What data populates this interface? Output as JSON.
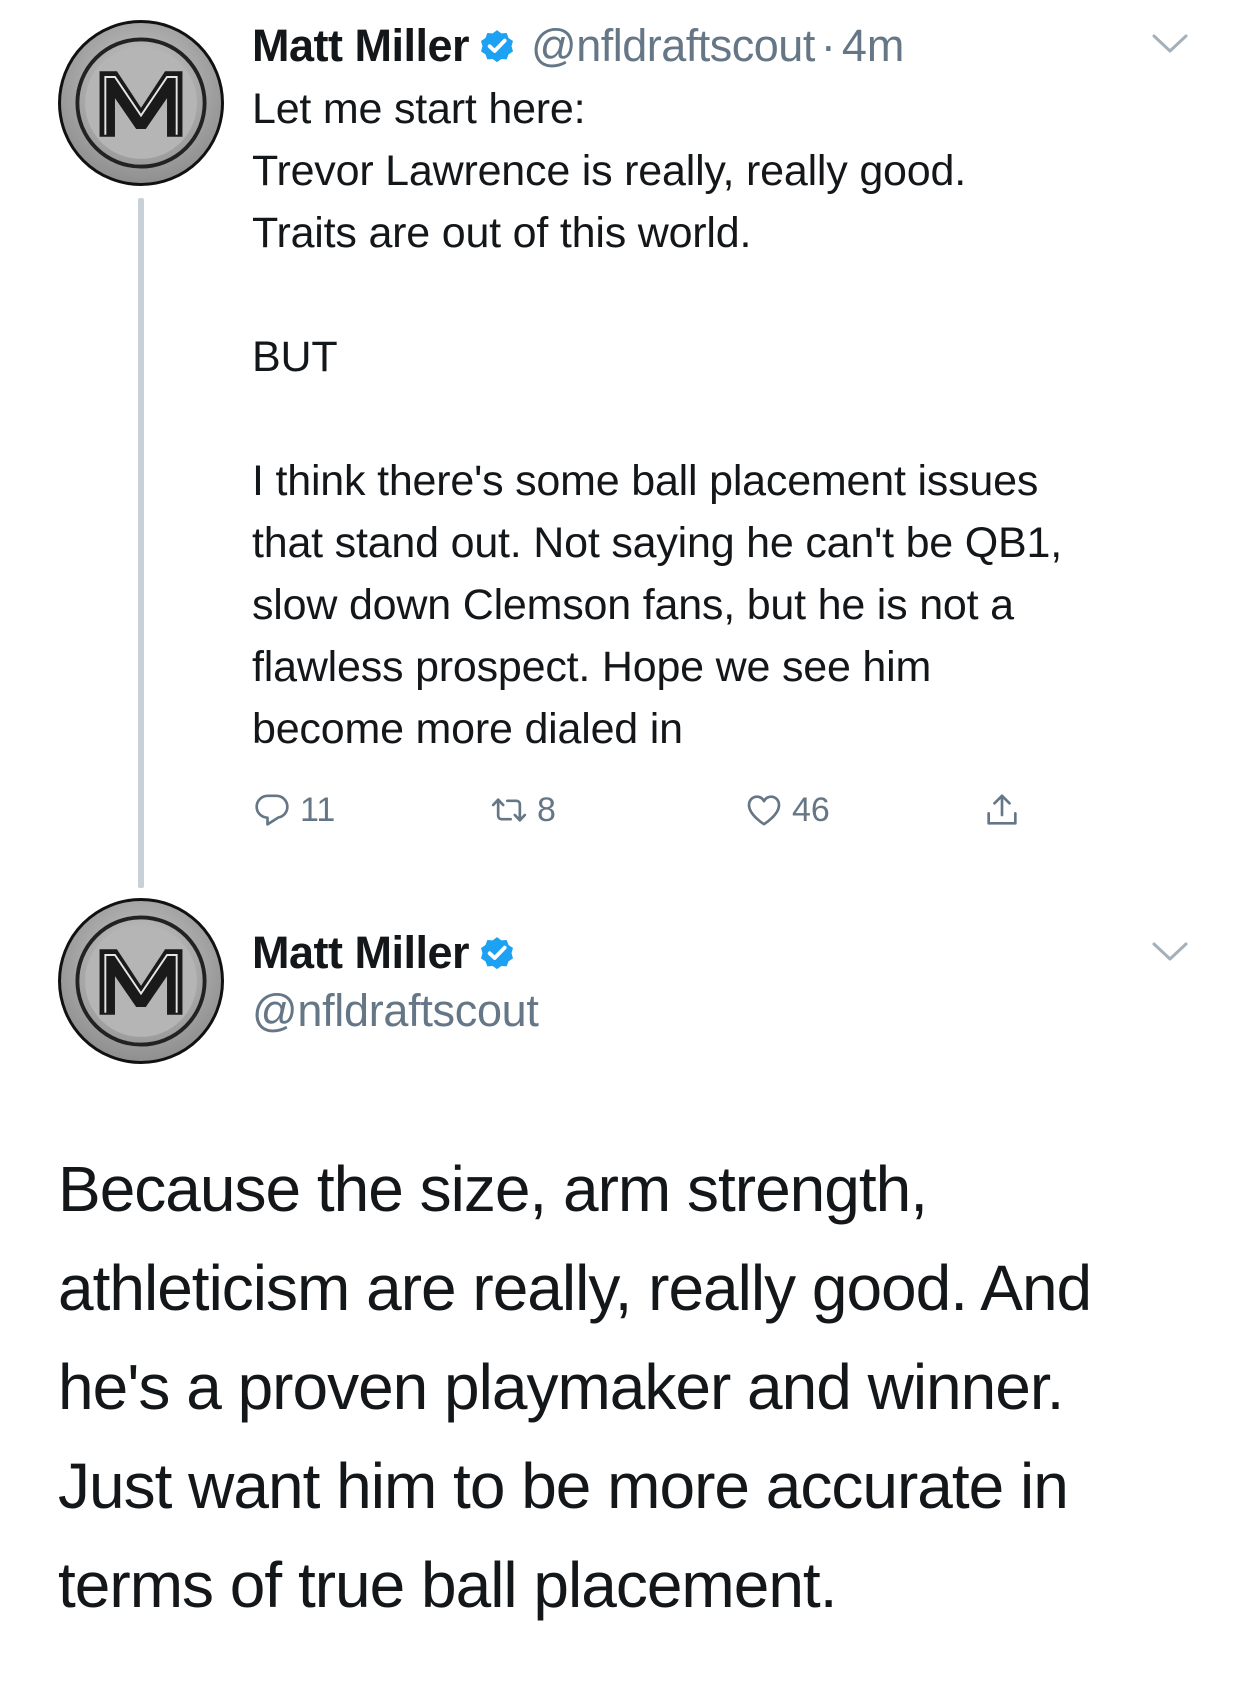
{
  "tweet1": {
    "name": "Matt Miller",
    "handle": "@nfldraftscout",
    "separator": "·",
    "time": "4m",
    "lines": {
      "l1": "Let me start here:",
      "l2": "Trevor Lawrence is really, really good.",
      "l3": "Traits are out of this world.",
      "l4": "BUT",
      "l5": "I think there's some ball placement issues",
      "l6": "that stand out. Not saying he can't be QB1,",
      "l7": "slow down Clemson fans, but he is not a",
      "l8": "flawless prospect. Hope we see him",
      "l9": "become more dialed in"
    },
    "actions": {
      "reply_count": "11",
      "retweet_count": "8",
      "like_count": "46"
    }
  },
  "tweet2": {
    "name": "Matt Miller",
    "handle": "@nfldraftscout",
    "lines": {
      "l1": "Because the size, arm strength,",
      "l2": "athleticism are really, really good. And",
      "l3": "he's a proven playmaker and winner.",
      "l4": "Just want him to be more accurate in",
      "l5": "terms of true ball placement."
    }
  },
  "icons": {
    "avatar": "m-logo-avatar",
    "verified": "verified-badge-icon",
    "chevron": "chevron-down-icon",
    "reply": "reply-icon",
    "retweet": "retweet-icon",
    "like": "heart-icon",
    "share": "share-icon"
  },
  "colors": {
    "text": "#14171a",
    "secondary": "#657786",
    "verified": "#1da1f2",
    "thread_line": "#c8d1d8"
  }
}
